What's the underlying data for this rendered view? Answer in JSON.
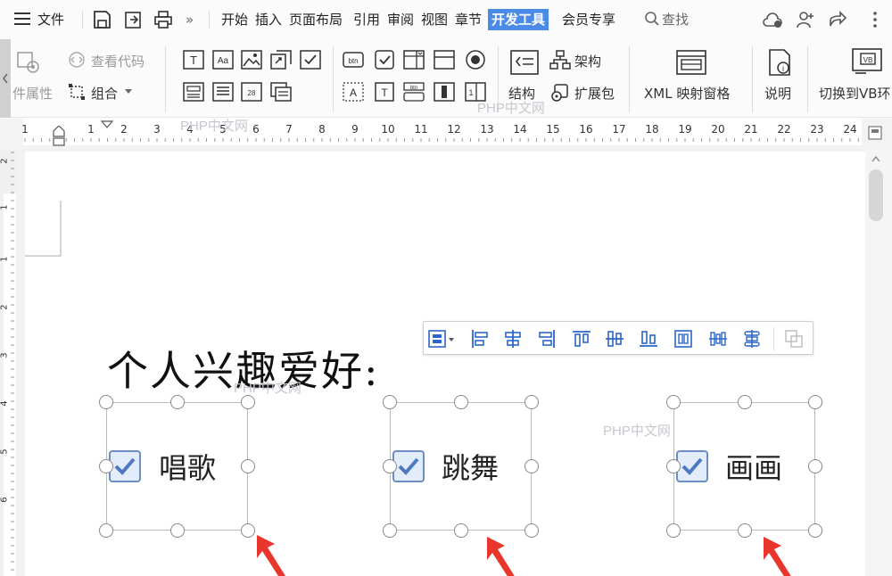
{
  "menubar": {
    "file_label": "文件",
    "items": [
      "开始",
      "插入",
      "页面布局",
      "引用",
      "审阅",
      "视图",
      "章节",
      "开发工具",
      "会员专享"
    ],
    "active": "开发工具",
    "search_label": "查找",
    "more_label": "»",
    "active_color": "#4b8be8"
  },
  "ribbon": {
    "control_properties": "件属性",
    "view_code": "查看代码",
    "group": "组合",
    "structure": "结构",
    "schema": "架构",
    "expansion_pack": "扩展包",
    "xml_mapping": "XML 映射窗格",
    "description": "说明",
    "switch_vb": "切换到VB环"
  },
  "ruler": {
    "numbers": [
      "1",
      "1",
      "2",
      "3",
      "4",
      "5",
      "6",
      "7",
      "8",
      "9",
      "10",
      "11",
      "12",
      "13",
      "14",
      "15",
      "16",
      "17",
      "18",
      "19",
      "20",
      "21",
      "22",
      "23",
      "24"
    ],
    "vertical_numbers": [
      "2",
      "1",
      "1",
      "2",
      "3",
      "4",
      "5",
      "6"
    ]
  },
  "document": {
    "heading": "个人兴趣爱好:",
    "checkboxes": [
      {
        "label": "唱歌",
        "checked": true
      },
      {
        "label": "跳舞",
        "checked": true
      },
      {
        "label": "画画",
        "checked": true
      }
    ],
    "checkbox_color": "#6c8ec7"
  },
  "watermark": "PHP中文网"
}
